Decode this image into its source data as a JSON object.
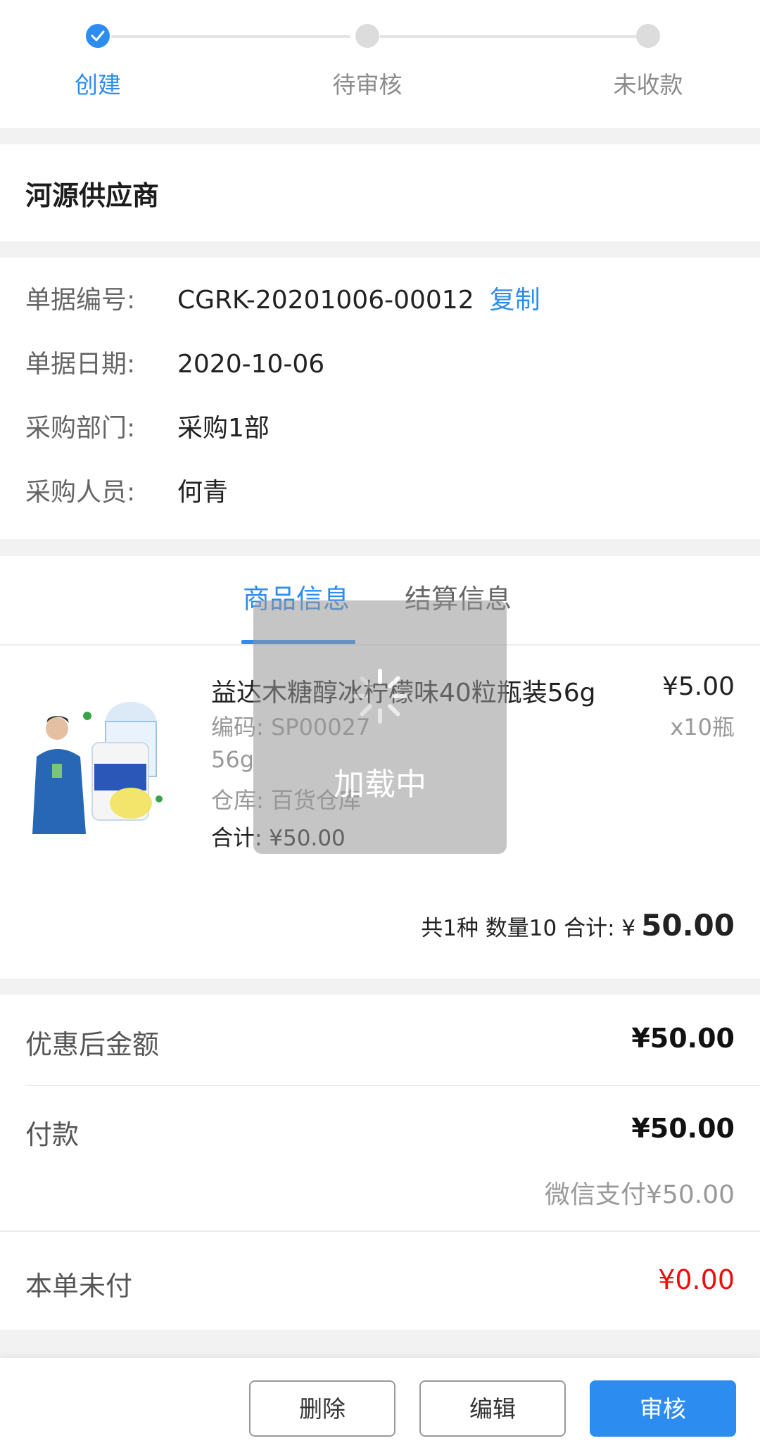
{
  "steps": [
    {
      "label": "创建",
      "active": true
    },
    {
      "label": "待审核",
      "active": false
    },
    {
      "label": "未收款",
      "active": false
    }
  ],
  "supplier": {
    "name": "河源供应商"
  },
  "info": {
    "order_no_label": "单据编号:",
    "order_no": "CGRK-20201006-00012",
    "copy_label": "复制",
    "date_label": "单据日期:",
    "date": "2020-10-06",
    "dept_label": "采购部门:",
    "dept": "采购1部",
    "staff_label": "采购人员:",
    "staff": "何青"
  },
  "tabs": [
    "商品信息",
    "结算信息"
  ],
  "product": {
    "name": "益达木糖醇冰柠檬味40粒瓶装56g",
    "code": "编码: SP00027",
    "spec": "56g",
    "warehouse": "仓库: 百货仓库",
    "total": "合计: ¥50.00",
    "price": "¥5.00",
    "qty": "x10瓶"
  },
  "summary": {
    "text": "共1种 数量10 合计: ¥",
    "amount": "50.00"
  },
  "amounts": {
    "discount_label": "优惠后金额",
    "discount_value": "¥50.00",
    "pay_label": "付款",
    "pay_value": "¥50.00",
    "pay_method": "微信支付¥50.00",
    "unpaid_label": "本单未付",
    "unpaid_value": "¥0.00"
  },
  "buttons": {
    "delete": "删除",
    "edit": "编辑",
    "approve": "审核"
  },
  "loading": {
    "text": "加载中"
  },
  "colors": {
    "accent": "#2d8cf0",
    "danger": "#f00c0c"
  }
}
